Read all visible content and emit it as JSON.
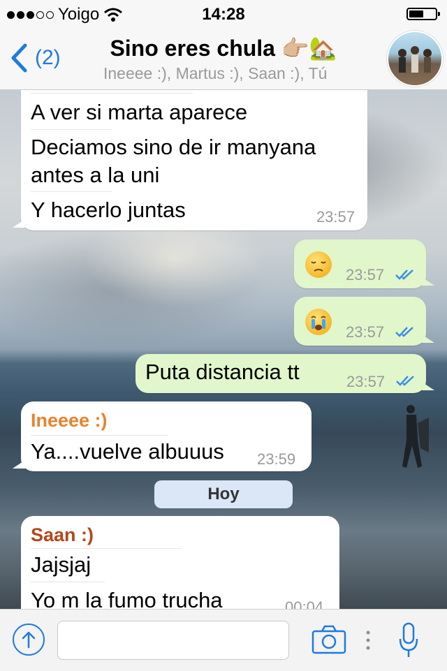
{
  "status_bar": {
    "carrier": "Yoigo",
    "time": "14:28",
    "signal_bars_filled": 3,
    "signal_bars_total": 5
  },
  "header": {
    "back_count": "(2)",
    "title": "Sino eres chula 👉🏼🏡",
    "subtitle": "Ineeee :), Martus :), Saan :), Tú"
  },
  "messages": [
    {
      "type": "incoming",
      "lines": [
        "A ver si marta aparece",
        "Deciamos sino de ir manyana",
        "antes a la uni",
        "Y hacerlo juntas"
      ],
      "time": "23:57"
    },
    {
      "type": "outgoing",
      "emoji": "😔",
      "time": "23:57",
      "read": true
    },
    {
      "type": "outgoing",
      "emoji": "😭",
      "time": "23:57",
      "read": true
    },
    {
      "type": "outgoing",
      "text": "Puta distancia tt",
      "time": "23:57",
      "read": true
    },
    {
      "type": "incoming",
      "sender": "Ineeee :)",
      "sender_color": "#e9832a",
      "text": "Ya....vuelve albuuus",
      "time": "23:59"
    },
    {
      "type": "date_chip",
      "text": "Hoy"
    },
    {
      "type": "incoming",
      "sender": "Saan :)",
      "sender_color": "#b4471b",
      "lines": [
        "Jajsjaj",
        "Yo m la fumo trucha"
      ],
      "time": "00:04"
    }
  ],
  "input_bar": {
    "placeholder": "",
    "icons": [
      "attach-icon",
      "camera-icon",
      "more-icon",
      "microphone-icon"
    ]
  },
  "colors": {
    "accent": "#1f7bde",
    "outgoing_bubble": "#e1f6cb",
    "incoming_bubble": "#ffffff",
    "read_ticks": "#3b8ee6"
  }
}
